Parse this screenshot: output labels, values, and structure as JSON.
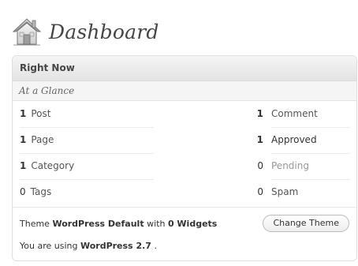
{
  "header": {
    "title": "Dashboard"
  },
  "widget": {
    "title": "Right Now",
    "subhead": "At a Glance",
    "content_rows": [
      {
        "count": "1",
        "label": "Post"
      },
      {
        "count": "1",
        "label": "Page"
      },
      {
        "count": "1",
        "label": "Category"
      },
      {
        "count": "0",
        "label": "Tags"
      }
    ],
    "discussion_rows": [
      {
        "count": "1",
        "label": "Comment"
      },
      {
        "count": "1",
        "label": "Approved"
      },
      {
        "count": "0",
        "label": "Pending"
      },
      {
        "count": "0",
        "label": "Spam"
      }
    ],
    "theme": {
      "prefix": "Theme",
      "name": "WordPress Default",
      "middle": "with",
      "widgets": "0 Widgets",
      "change_label": "Change Theme"
    },
    "version": {
      "prefix": "You are using",
      "name": "WordPress 2.7",
      "suffix": "."
    }
  },
  "colors": {
    "pending_label": "#999999",
    "title_text": "#464646"
  }
}
